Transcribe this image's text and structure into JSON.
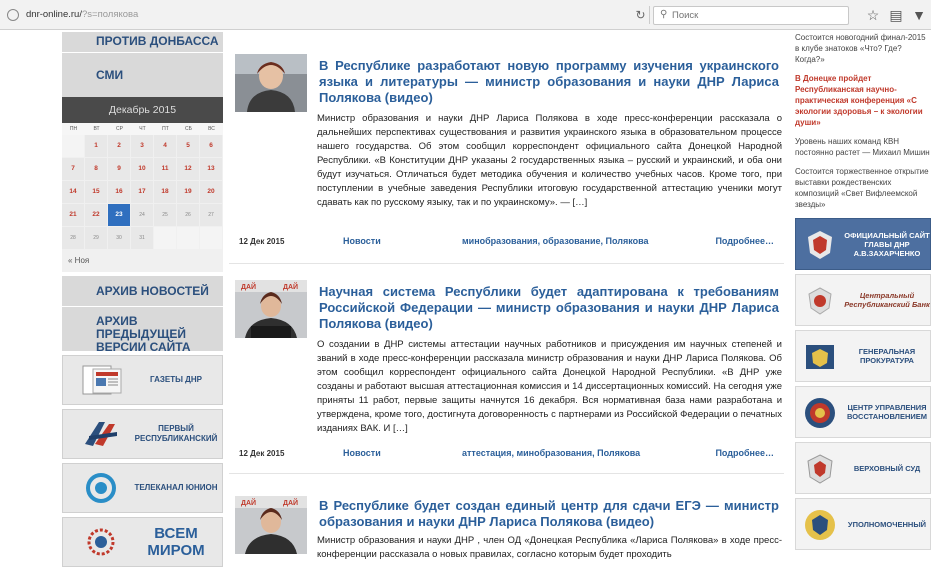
{
  "browser": {
    "url_host": "dnr-online.ru/",
    "url_query": "?s=полякова",
    "search_placeholder": "Поиск"
  },
  "sidebar": {
    "top_link": "ПРОТИВ ДОНБАССА",
    "smi": "СМИ",
    "calendar": {
      "month": "Декабрь 2015",
      "weekdays": [
        "ПН",
        "ВТ",
        "СР",
        "ЧТ",
        "ПТ",
        "СБ",
        "ВС"
      ],
      "rows": [
        [
          "",
          "1",
          "2",
          "3",
          "4",
          "5",
          "6"
        ],
        [
          "7",
          "8",
          "9",
          "10",
          "11",
          "12",
          "13"
        ],
        [
          "14",
          "15",
          "16",
          "17",
          "18",
          "19",
          "20"
        ],
        [
          "21",
          "22",
          "23",
          "24",
          "25",
          "26",
          "27"
        ],
        [
          "28",
          "29",
          "30",
          "31",
          "",
          "",
          ""
        ]
      ],
      "today": "23",
      "prev": "« Ноя"
    },
    "archive_news": "АРХИВ НОВОСТЕЙ",
    "archive_prev": "АРХИВ ПРЕДЫДУЩЕЙ ВЕРСИИ САЙТА",
    "banners": [
      {
        "label": "ГАЗЕТЫ ДНР",
        "icon": "newspaper-icon"
      },
      {
        "label": "ПЕРВЫЙ РЕСПУБЛИКАНСКИЙ",
        "icon": "first-republican-logo"
      },
      {
        "label": "ТЕЛЕКАНАЛ ЮНИОН",
        "icon": "union-tv-logo"
      },
      {
        "label": "ВСЕМ МИРОМ",
        "icon": "vsem-mirom-logo"
      }
    ]
  },
  "articles": [
    {
      "title": "В Республике разработают новую программу изучения украинского языка и литературы — министр образования и науки ДНР Лариса Полякова (видео)",
      "body": "Министр образования и науки ДНР Лариса Полякова в ходе пресс-конференции рассказала о дальнейших перспективах существования и развития украинского языка в образовательном процессе нашего государства. Об этом сообщил корреспондент официального сайта Донецкой Народной Республики. «В Конституции ДНР указаны 2 государственных языка – русский и украинский, и оба они будут изучаться. Отличаться будет методика обучения и количество учебных часов. Кроме того, при поступлении в учебные заведения Республики итоговую государственной аттестацию ученики могут сдавать как по русскому языку, так и по украинскому». — […]",
      "date": "12 Дек 2015",
      "category": "Новости",
      "tags": "минобразования, образование, Полякова",
      "more": "Подробнее…"
    },
    {
      "title": "Научная система Республики будет адаптирована к требованиям Российской Федерации — министр образования и науки ДНР Лариса Полякова (видео)",
      "body": "О создании в ДНР системы аттестации научных работников и присуждения им научных степеней и званий в ходе пресс-конференции рассказала министр образования и науки ДНР Лариса Полякова. Об этом сообщил корреспондент официального сайта Донецкой Народной Республики. «В ДНР уже созданы и работают высшая аттестационная комиссия и 14 диссертационных комиссий. На сегодня уже приняты 11 работ, первые защиты начнутся 16 декабря. Вся нормативная база нами разработана и утверждена, кроме того, достигнута договоренность с партнерами из Российской Федерации о печатных изданиях ВАК. И […]",
      "date": "12 Дек 2015",
      "category": "Новости",
      "tags": "аттестация, минобразования, Полякова",
      "more": "Подробнее…"
    },
    {
      "title": "В Республике будет создан единый центр для сдачи ЕГЭ — министр образования и науки ДНР Лариса Полякова (видео)",
      "body": "Министр образования и науки ДНР , член ОД «Донецкая Республика «Лариса Полякова» в ходе пресс-конференции рассказала о новых правилах, согласно которым будет проходить"
    }
  ],
  "right": {
    "news": [
      {
        "text": "Состоится новогодний финал-2015 в клубе знатоков «Что? Где? Когда?»",
        "red": false
      },
      {
        "text": "В Донецке пройдет Республиканская научно-практическая конференция «С экологии здоровья – к экологии души»",
        "red": true
      },
      {
        "text": "Уровень наших команд КВН постоянно растет — Михаил Мишин",
        "red": false
      },
      {
        "text": "Состоится торжественное открытие выставки рождественских композиций «Свет Вифлеемской звезды»",
        "red": false
      }
    ],
    "banners": [
      {
        "label": "ОФИЦИАЛЬНЫЙ САЙТ ГЛАВЫ ДНР А.В.ЗАХАРЧЕНКО",
        "icon": "dnr-coat-of-arms"
      },
      {
        "label": "Центральный Республиканский Банк",
        "icon": "central-bank-logo"
      },
      {
        "label": "ГЕНЕРАЛЬНАЯ ПРОКУРАТУРА",
        "icon": "prosecutor-emblem"
      },
      {
        "label": "ЦЕНТР УПРАВЛЕНИЯ ВОССТАНОВЛЕНИЕМ",
        "icon": "restoration-center-emblem"
      },
      {
        "label": "ВЕРХОВНЫЙ СУД",
        "icon": "supreme-court-emblem"
      },
      {
        "label": "УПОЛНОМОЧЕННЫЙ",
        "icon": "ombudsman-emblem"
      }
    ]
  },
  "colors": {
    "link_blue": "#2b5f9a",
    "nav_blue": "#2b4f7d",
    "red": "#c0392b",
    "calendar_header": "#4a4a4a",
    "today": "#2f6fbf"
  }
}
